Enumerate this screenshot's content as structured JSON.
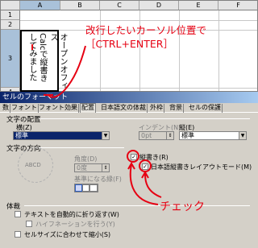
{
  "sheet": {
    "columns": [
      "A",
      "B",
      "C",
      "D",
      "E",
      "F"
    ],
    "selected_column": "A",
    "rows": [
      "1",
      "2",
      "3",
      "4"
    ],
    "selected_row": "3",
    "cell_a3_col1": "オープンオフィス",
    "cell_a3_col2": "Calcで縦書き",
    "cell_a3_col3": "してみました"
  },
  "annotations": {
    "line1": "改行したいカーソル位置で",
    "line2": "［CTRL+ENTER］",
    "check_label": "チェック"
  },
  "dialog": {
    "title": "セルのフォーマット",
    "tabs": [
      "数",
      "フォント",
      "フォント効果",
      "配置",
      "日本語文の体裁",
      "外枠",
      "背景",
      "セルの保護"
    ],
    "active_tab": "配置",
    "text_alignment": {
      "section": "文字の配置",
      "horizontal_label": "横(Z)",
      "horizontal_value": "標準",
      "indent_label": "インデント(N)",
      "indent_value": "0pt",
      "vertical_label": "縦(E)",
      "vertical_value": "標準"
    },
    "text_direction": {
      "section": "文字の方向",
      "angle_label": "角度(D)",
      "angle_value": "0度",
      "reference_label": "基準になる縁(F)",
      "dial_text": "ABCD",
      "vertical_stack_label": "縦書き(R)",
      "vertical_stack_checked": true,
      "asian_layout_label": "日本語縦書きレイアウトモード(M)",
      "asian_layout_checked": true
    },
    "properties": {
      "section": "体裁",
      "wrap_label": "テキストを自動的に折り返す(W)",
      "hyphen_label": "ハイフネーションを行う(Y)",
      "shrink_label": "セルサイズに合わせて縮小(S)"
    }
  },
  "colors": {
    "annotation": "#e60012",
    "selection": "#0a246a",
    "dialog_bg": "#d4d0c8"
  }
}
